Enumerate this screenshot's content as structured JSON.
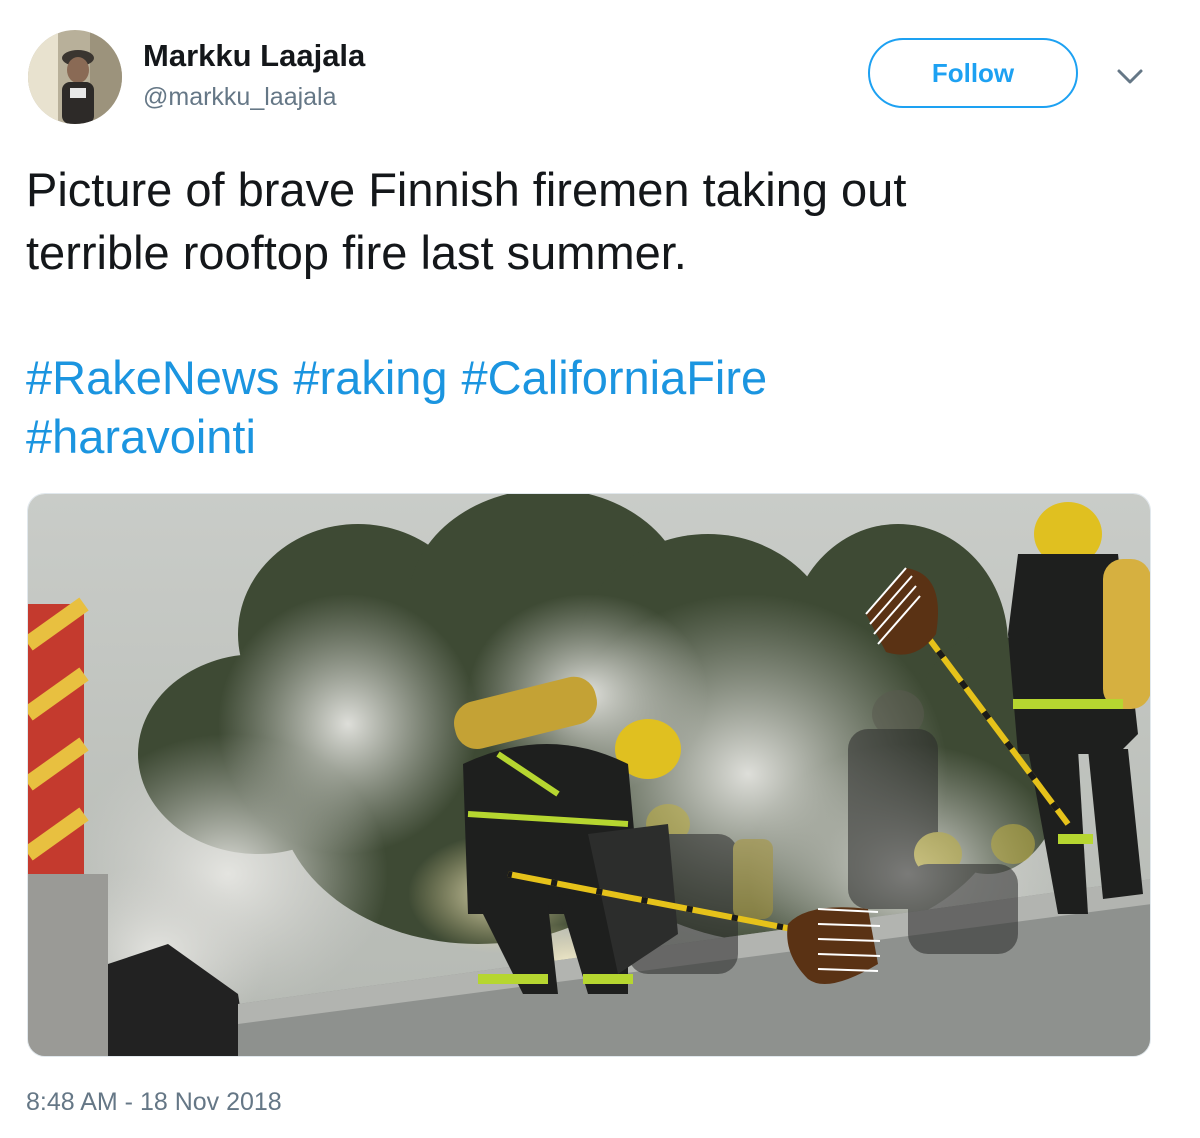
{
  "tweet": {
    "author_name": "Markku Laajala",
    "author_handle": "@markku_laajala",
    "follow_label": "Follow",
    "text_line1": "Picture of brave Finnish firemen taking out",
    "text_line2": "terrible rooftop fire last summer.",
    "hashtags": [
      "#RakeNews",
      "#raking",
      "#CaliforniaFire",
      "#haravointi"
    ],
    "timestamp": "8:48 AM - 18 Nov 2018"
  },
  "icons": {
    "more": "chevron-down-icon",
    "avatar": "avatar"
  },
  "colors": {
    "link": "#1b95e0",
    "follow": "#1da1f2",
    "secondary_text": "#657786",
    "primary_text": "#14171a"
  }
}
